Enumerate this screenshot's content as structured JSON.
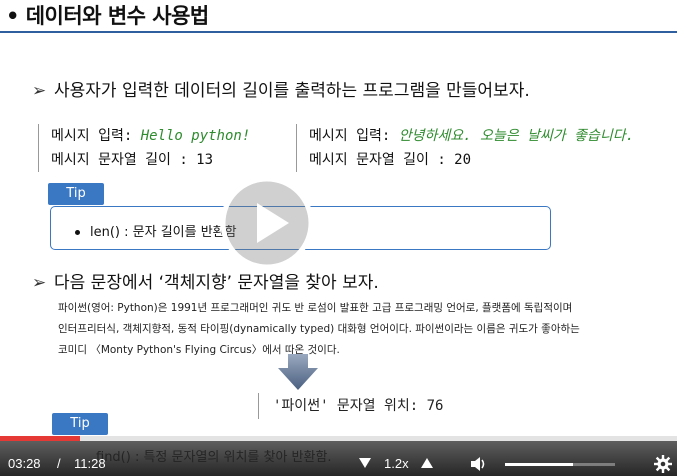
{
  "slide": {
    "title": "• 데이터와 변수 사용법",
    "bullet1": "사용자가 입력한 데이터의 길이를 출력하는 프로그램을 만들어보자.",
    "output_left": {
      "line1_label": "메시지 입력: ",
      "line1_value": "Hello python!",
      "line2": "메시지 문자열 길이 : 13"
    },
    "output_right": {
      "line1_label": "메시지 입력: ",
      "line1_value": "안녕하세요. 오늘은 날씨가 좋습니다.",
      "line2": "메시지 문자열 길이 : 20"
    },
    "tip_label": "Tip",
    "tip1_text": "len() : 문자 길이를 반환함",
    "bullet2": "다음 문장에서 ‘객체지향’ 문자열을 찾아 보자.",
    "paragraph": [
      "파이썬(영어: Python)은 1991년 프로그래머인 귀도 반 로섬이 발표한 고급 프로그래밍 언어로, 플랫폼에 독립적이며",
      "인터프리터식, 객체지향적, 동적 타이핑(dynamically typed) 대화형 언어이다. 파이썬이라는 이름은 귀도가 좋아하는",
      "코미디 〈Monty Python's Flying Circus〉에서 따온 것이다."
    ],
    "result": "'파이썬' 문자열 위치: 76",
    "tip2_label": "Tip",
    "tip2_text": "find() : 특정 문자열의 위치를 찾아 반환함."
  },
  "player": {
    "current_time": "03:28",
    "separator": "/",
    "total_time": "11:28",
    "progress": 0.118,
    "speed": "1.2x",
    "volume": 0.62,
    "icons": [
      "play-icon",
      "speed-down-icon",
      "speed-up-icon",
      "volume-icon",
      "gear-icon"
    ]
  }
}
